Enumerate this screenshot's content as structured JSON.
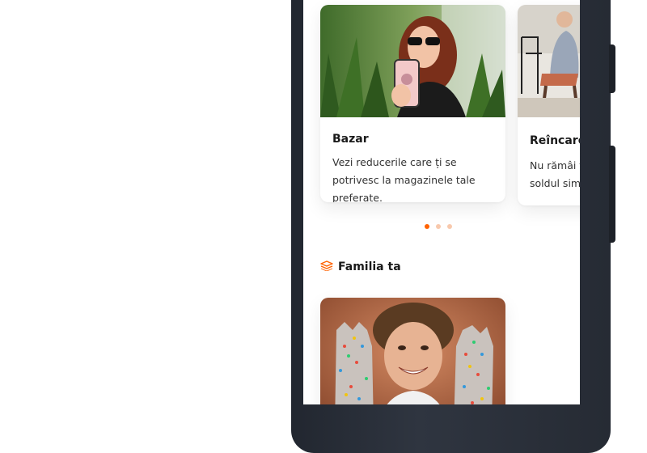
{
  "colors": {
    "accent": "#ff6200",
    "accent_light": "#f8c9ad"
  },
  "carousel": {
    "cards": [
      {
        "title": "Bazar",
        "text": "Vezi reducerile care ți se potrivesc la magazinele tale preferate."
      },
      {
        "title": "Reîncarcă",
        "text_line1": "Nu rămâi fă",
        "text_line2": "soldul simpl"
      }
    ],
    "page_count": 3,
    "active_index": 0
  },
  "family_section": {
    "title": "Familia ta",
    "icon": "stack-icon"
  }
}
